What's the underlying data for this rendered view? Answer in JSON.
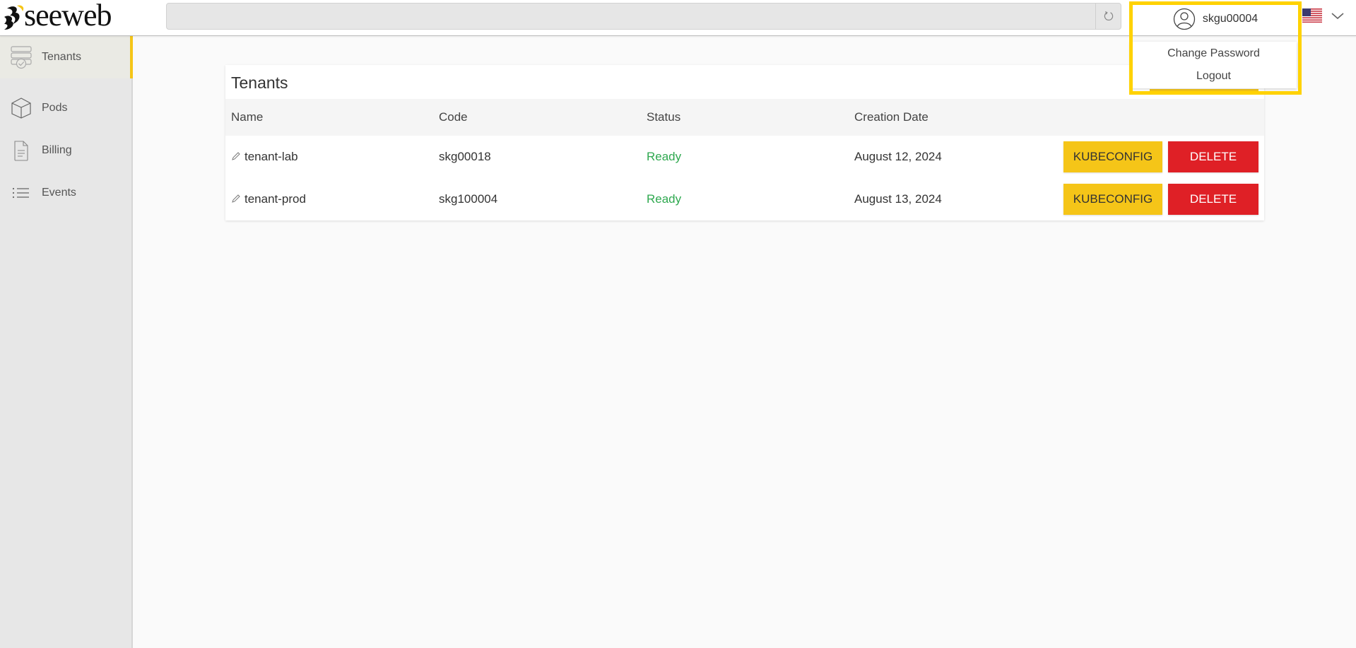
{
  "header": {
    "logo_text": "seeweb",
    "search": {
      "value": "",
      "placeholder": ""
    },
    "refresh_icon": "refresh-icon",
    "user": {
      "username": "skgu00004",
      "icon": "user-circle-icon",
      "menu": [
        {
          "label": "Change Password"
        },
        {
          "label": "Logout"
        }
      ]
    },
    "language": {
      "flag": "us-flag-icon",
      "chevron": "chevron-down-icon"
    }
  },
  "sidebar": {
    "items": [
      {
        "label": "Tenants",
        "icon": "tenants-server-icon",
        "active": true
      },
      {
        "label": "Pods",
        "icon": "cube-icon",
        "active": false
      },
      {
        "label": "Billing",
        "icon": "document-icon",
        "active": false
      },
      {
        "label": "Events",
        "icon": "list-icon",
        "active": false
      }
    ]
  },
  "main": {
    "title": "Tenants",
    "columns": [
      "Name",
      "Code",
      "Status",
      "Creation Date"
    ],
    "rows": [
      {
        "name": "tenant-lab",
        "code": "skg00018",
        "status": "Ready",
        "created": "August 12, 2024",
        "kube_label": "KUBECONFIG",
        "delete_label": "DELETE"
      },
      {
        "name": "tenant-prod",
        "code": "skg100004",
        "status": "Ready",
        "created": "August 13, 2024",
        "kube_label": "KUBECONFIG",
        "delete_label": "DELETE"
      }
    ]
  },
  "colors": {
    "accent_yellow": "#f5c518",
    "highlight_border": "#ffd200",
    "delete_red": "#df2026",
    "status_ready": "#2ea84f"
  }
}
